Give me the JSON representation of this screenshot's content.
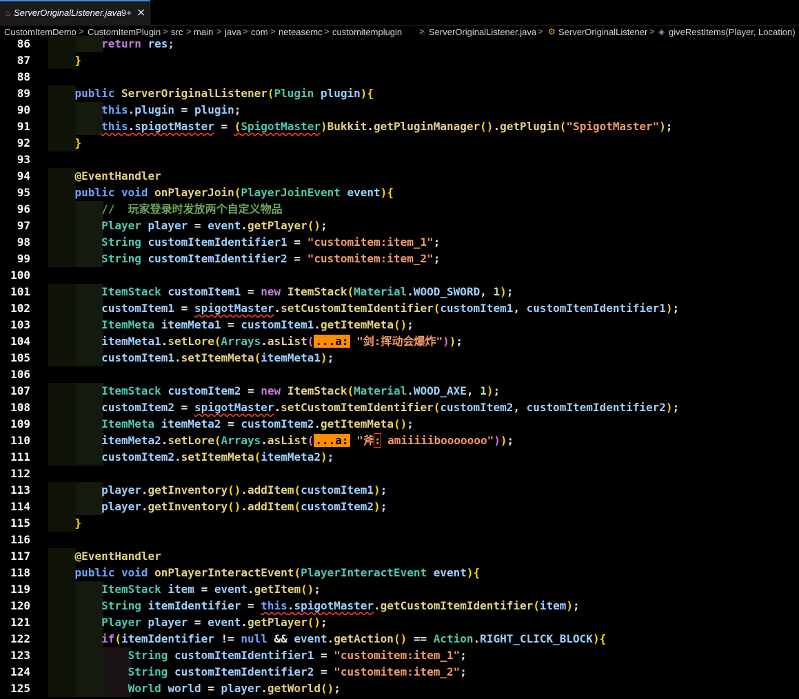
{
  "tab": {
    "title": "ServerOriginalListener.java",
    "badge": "9+",
    "close_glyph": "×",
    "file_icon": "java-file-icon"
  },
  "breadcrumb": {
    "items": [
      "CustomItemDemo",
      "CustomItemPlugin",
      "src",
      "main",
      "java",
      "com",
      "neteasemc",
      "customitemplugin",
      "ServerOriginalListener.java",
      "ServerOriginalListener",
      "giveRestItems(Player, Location)"
    ],
    "separator": ">"
  },
  "editor": {
    "lines": [
      {
        "n": "86"
      },
      {
        "n": "87"
      },
      {
        "n": "88"
      },
      {
        "n": "89"
      },
      {
        "n": "90"
      },
      {
        "n": "91"
      },
      {
        "n": "92"
      },
      {
        "n": "93"
      },
      {
        "n": "94"
      },
      {
        "n": "95"
      },
      {
        "n": "96"
      },
      {
        "n": "97"
      },
      {
        "n": "98"
      },
      {
        "n": "99"
      },
      {
        "n": "100"
      },
      {
        "n": "101"
      },
      {
        "n": "102"
      },
      {
        "n": "103"
      },
      {
        "n": "104"
      },
      {
        "n": "105"
      },
      {
        "n": "106"
      },
      {
        "n": "107"
      },
      {
        "n": "108"
      },
      {
        "n": "109"
      },
      {
        "n": "110"
      },
      {
        "n": "111"
      },
      {
        "n": "112"
      },
      {
        "n": "113"
      },
      {
        "n": "114"
      },
      {
        "n": "115"
      },
      {
        "n": "116"
      },
      {
        "n": "117"
      },
      {
        "n": "118"
      },
      {
        "n": "119"
      },
      {
        "n": "120"
      },
      {
        "n": "121"
      },
      {
        "n": "122"
      },
      {
        "n": "123"
      },
      {
        "n": "124"
      },
      {
        "n": "125"
      }
    ],
    "tokens": {
      "return": "return",
      "res": "res;",
      "close_brace": "}",
      "public": "public",
      "ctor_name": "ServerOriginalListener",
      "Plugin": "Plugin",
      "plugin": "plugin",
      "this": "this",
      "plugin_field": "plugin",
      "eq": " = ",
      "semi": ";",
      "spigotMaster": "spigotMaster",
      "SpigotMaster": "SpigotMaster",
      "Bukkit": "Bukkit",
      "getPluginManager": "getPluginManager",
      "getPlugin": "getPlugin",
      "str_spigot": "\"SpigotMaster\"",
      "EventHandler": "@EventHandler",
      "void": "void",
      "onPlayerJoin": "onPlayerJoin",
      "PlayerJoinEvent": "PlayerJoinEvent",
      "event": "event",
      "comment96": "//  玩家登录时发放两个自定义物品",
      "Player": "Player",
      "player": "player",
      "getPlayer": "getPlayer",
      "String": "String",
      "cid1": "customItemIdentifier1",
      "cid2": "customItemIdentifier2",
      "str_item1": "\"customitem:item_1\"",
      "str_item2": "\"customitem:item_2\"",
      "ItemStack": "ItemStack",
      "customItem1": "customItem1",
      "customItem2": "customItem2",
      "new": "new",
      "Material": "Material",
      "WOOD_SWORD": "WOOD_SWORD",
      "WOOD_AXE": "WOOD_AXE",
      "one": "1",
      "setCustomItemIdentifier": "setCustomItemIdentifier",
      "ItemMeta": "ItemMeta",
      "itemMeta1": "itemMeta1",
      "itemMeta2": "itemMeta2",
      "getItemMeta": "getItemMeta",
      "setLore": "setLore",
      "Arrays": "Arrays",
      "asList": "asList",
      "hint": "...a:",
      "str_sword": "\"剑:挥动会爆炸\"",
      "str_axe_a": "\"斧",
      "str_axe_b": ":",
      "str_axe_c": " amiiiiibooooooo\"",
      "setItemMeta": "setItemMeta",
      "getInventory": "getInventory",
      "addItem": "addItem",
      "onPlayerInteractEvent": "onPlayerInteractEvent",
      "PlayerInteractEvent": "PlayerInteractEvent",
      "item": "item",
      "getItem": "getItem",
      "itemIdentifier": "itemIdentifier",
      "getCustomItemIdentifier": "getCustomItemIdentifier",
      "if": "if",
      "neq": " != ",
      "null": "null",
      "and": " && ",
      "getAction": "getAction",
      "eqeq": " == ",
      "Action": "Action",
      "RIGHT_CLICK_BLOCK": "RIGHT_CLICK_BLOCK",
      "World": "World",
      "world": "world",
      "getWorld": "getWorld"
    }
  }
}
